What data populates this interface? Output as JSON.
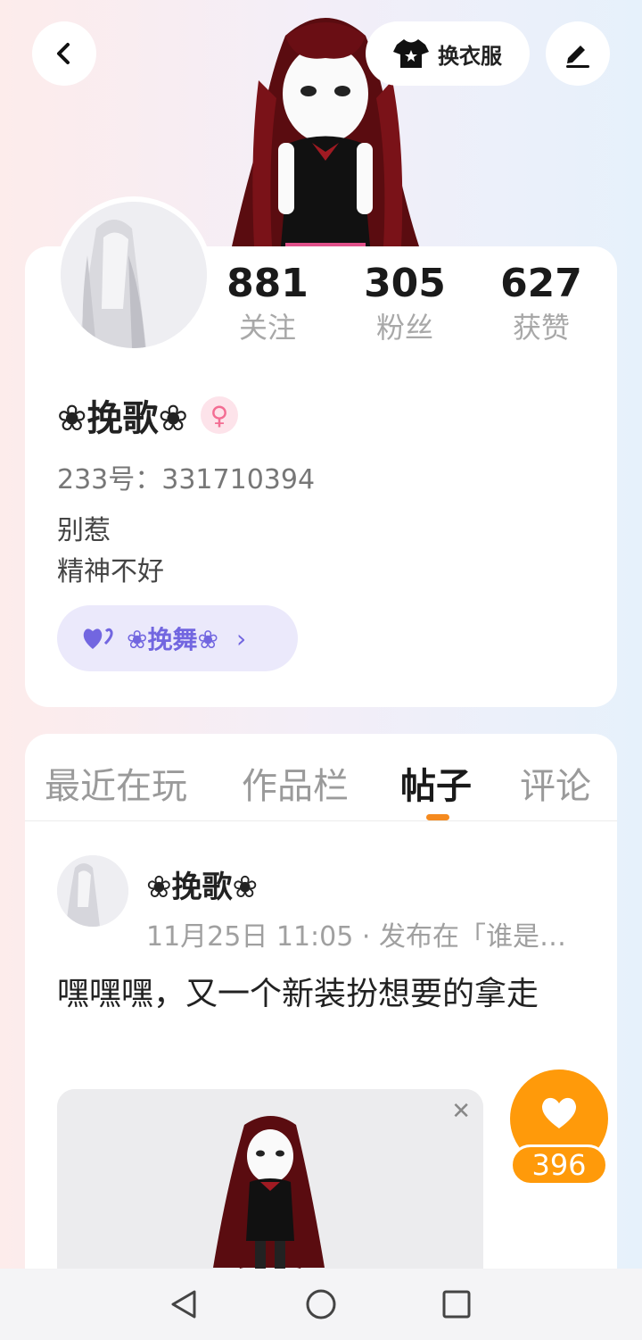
{
  "header": {
    "back_icon": "chevron-left-icon",
    "outfit_label": "换衣服",
    "outfit_icon": "tshirt-icon",
    "edit_icon": "pen-icon"
  },
  "profile": {
    "stats": [
      {
        "num": "881",
        "label": "关注"
      },
      {
        "num": "305",
        "label": "粉丝"
      },
      {
        "num": "627",
        "label": "获赞"
      }
    ],
    "name": "❀挽歌❀",
    "gender_icon": "female-icon",
    "id_line": "233号：331710394",
    "bio_line1": "别惹",
    "bio_line2": "精神不好",
    "group_label": "❀挽舞❀"
  },
  "tabs": [
    "最近在玩",
    "作品栏",
    "帖子",
    "评论"
  ],
  "post": {
    "author": "❀挽歌❀",
    "meta": "11月25日 11:05 · 发布在「谁是…",
    "text": "嘿嘿嘿，又一个新装扮想要的拿走",
    "likes": "396"
  },
  "colors": {
    "accent_orange": "#ff9a0a",
    "tab_underline": "#f58a1f",
    "group_purple": "#7266e0",
    "gender_pink": "#f36d93"
  }
}
